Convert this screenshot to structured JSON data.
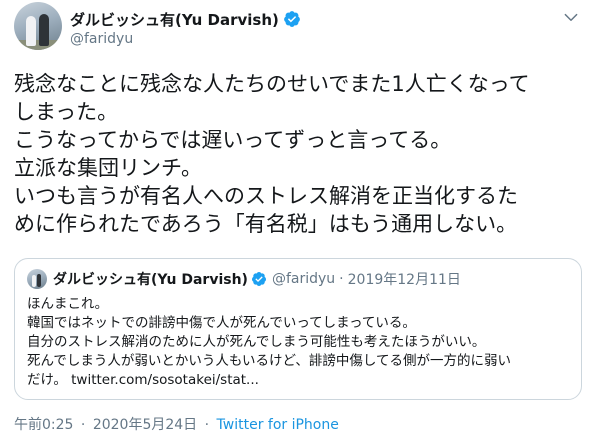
{
  "author": {
    "display_name": "ダルビッシュ有(Yu Darvish)",
    "handle": "@faridyu",
    "verified_icon": "verified-badge-icon"
  },
  "tweet": {
    "lines": [
      "残念なことに残念な人たちのせいでまた1人亡くなって",
      "しまった。",
      "こうなってからでは遅いってずっと言ってる。",
      "立派な集団リンチ。",
      "いつも言うが有名人へのストレス解消を正当化するた",
      "めに作られたであろう「有名税」はもう通用しない。"
    ]
  },
  "quoted": {
    "display_name": "ダルビッシュ有(Yu Darvish)",
    "handle": "@faridyu",
    "separator": "·",
    "date": "2019年12月11日",
    "lines": [
      "ほんまこれ。",
      "韓国ではネットでの誹謗中傷で人が死んでいってしまっている。",
      "自分のストレス解消のために人が死んでしまう可能性も考えたほうがいい。",
      "死んでしまう人が弱いとかいう人もいるけど、誹謗中傷してる側が一方的に弱い",
      "だけ。 twitter.com/sosotakei/stat..."
    ]
  },
  "meta": {
    "time": "午前0:25",
    "separator": "·",
    "date": "2020年5月24日",
    "source": "Twitter for iPhone"
  },
  "colors": {
    "accent": "#1da1f2",
    "link": "#1b95e0",
    "secondary_text": "#657786",
    "border": "#ccd6dd"
  }
}
